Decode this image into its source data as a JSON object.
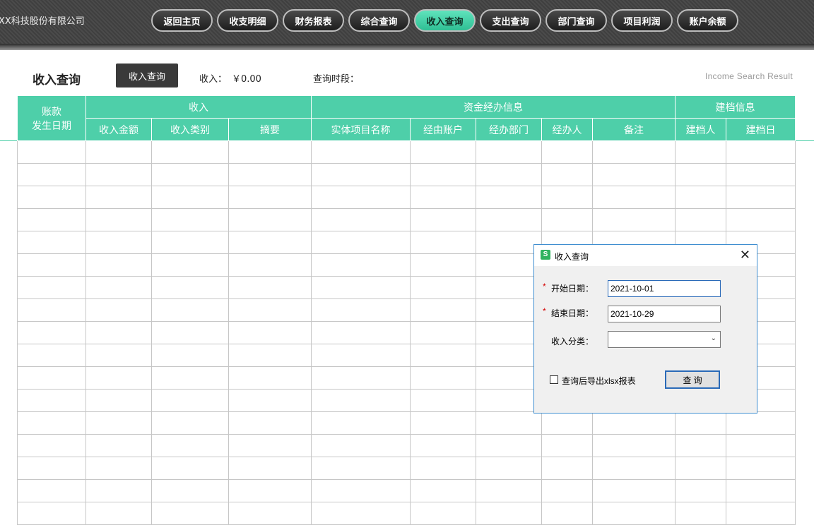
{
  "header": {
    "company": "XX科技股份有限公司",
    "nav": [
      {
        "label": "返回主页",
        "active": false
      },
      {
        "label": "收支明细",
        "active": false
      },
      {
        "label": "财务报表",
        "active": false
      },
      {
        "label": "综合查询",
        "active": false
      },
      {
        "label": "收入查询",
        "active": true
      },
      {
        "label": "支出查询",
        "active": false
      },
      {
        "label": "部门查询",
        "active": false
      },
      {
        "label": "项目利润",
        "active": false
      },
      {
        "label": "账户余额",
        "active": false
      }
    ]
  },
  "page": {
    "title": "收入查询",
    "query_button": "收入查询",
    "income_label": "收入：",
    "income_value": "￥0.00",
    "period_label": "查询时段：",
    "result_label": "Income Search Result"
  },
  "table": {
    "group_headers": {
      "date_line1": "账款",
      "date_line2": "发生日期",
      "income": "收入",
      "fund": "资金经办信息",
      "archive": "建档信息"
    },
    "columns": [
      "收入金额",
      "收入类别",
      "摘要",
      "实体项目名称",
      "经由账户",
      "经办部门",
      "经办人",
      "备注",
      "建档人",
      "建档日"
    ],
    "empty_rows": 17
  },
  "dialog": {
    "title": "收入查询",
    "start_label": "开始日期：",
    "start_value": "2021-10-01",
    "end_label": "结束日期：",
    "end_value": "2021-10-29",
    "category_label": "收入分类：",
    "category_value": "",
    "export_label": "查询后导出xlsx报表",
    "submit_label": "查 询",
    "required_mark": "*"
  },
  "colors": {
    "accent": "#4ecfa9",
    "topbar": "#444444"
  }
}
